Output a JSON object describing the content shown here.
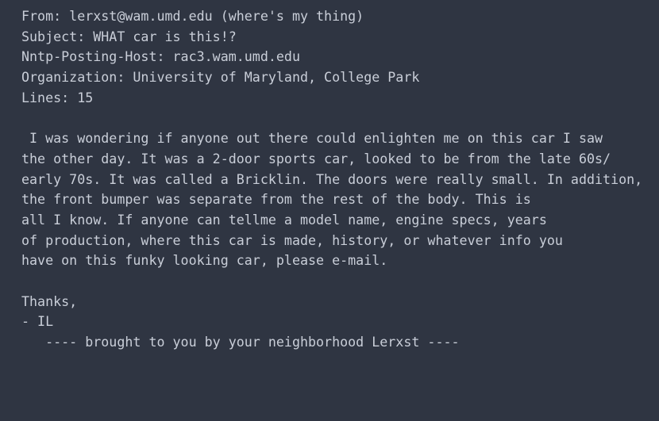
{
  "header": {
    "from": "From: lerxst@wam.umd.edu (where's my thing)",
    "subject": "Subject: WHAT car is this!?",
    "host": "Nntp-Posting-Host: rac3.wam.umd.edu",
    "organization": "Organization: University of Maryland, College Park",
    "lines": "Lines: 15"
  },
  "body": [
    " I was wondering if anyone out there could enlighten me on this car I saw",
    "the other day. It was a 2-door sports car, looked to be from the late 60s/",
    "early 70s. It was called a Bricklin. The doors were really small. In addition,",
    "the front bumper was separate from the rest of the body. This is",
    "all I know. If anyone can tellme a model name, engine specs, years",
    "of production, where this car is made, history, or whatever info you",
    "have on this funky looking car, please e-mail."
  ],
  "signature": {
    "thanks": "Thanks,",
    "name": "- IL",
    "tagline": "   ---- brought to you by your neighborhood Lerxst ----"
  },
  "colors": {
    "background": "#2f3542",
    "text": "#c9ced8"
  }
}
